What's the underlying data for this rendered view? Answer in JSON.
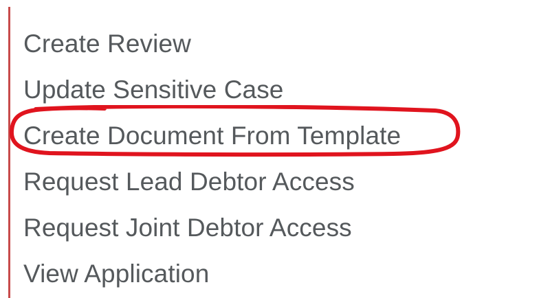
{
  "menu": {
    "items": [
      {
        "label": "Create Review"
      },
      {
        "label": "Update Sensitive Case"
      },
      {
        "label": "Create Document From Template",
        "highlighted": true
      },
      {
        "label": "Request Lead Debtor Access"
      },
      {
        "label": "Request Joint Debtor Access"
      },
      {
        "label": "View Application"
      }
    ]
  },
  "colors": {
    "text": "#55595c",
    "left_border": "#c74b4b",
    "highlight_outline": "#e0141e"
  }
}
